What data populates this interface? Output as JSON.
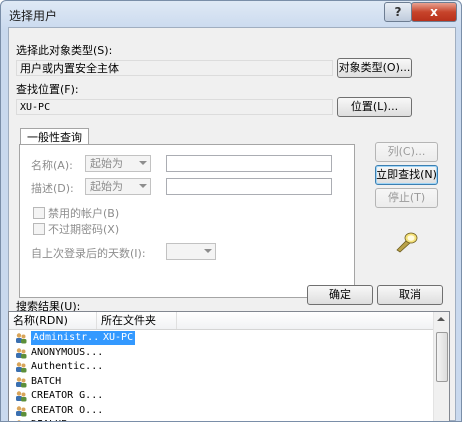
{
  "window": {
    "title": "选择用户",
    "help_label": "?",
    "close_label": "x"
  },
  "object_type": {
    "label": "选择此对象类型(S):",
    "value": "用户或内置安全主体",
    "button": "对象类型(O)..."
  },
  "location": {
    "label": "查找位置(F):",
    "value": "XU-PC",
    "button": "位置(L)..."
  },
  "query": {
    "tab": "一般性查询",
    "name_label": "名称(A):",
    "name_mode": "起始为",
    "desc_label": "描述(D):",
    "desc_mode": "起始为",
    "disabled_accounts": "禁用的帐户(B)",
    "non_expiring": "不过期密码(X)",
    "days_label": "自上次登录后的天数(I):"
  },
  "side_buttons": {
    "columns": "列(C)...",
    "find_now": "立即查找(N)",
    "stop": "停止(T)"
  },
  "actions": {
    "ok": "确定",
    "cancel": "取消"
  },
  "results": {
    "label": "搜索结果(U):",
    "columns": [
      "名称(RDN)",
      "所在文件夹"
    ],
    "rows": [
      {
        "name": "Administr...",
        "folder": "XU-PC"
      },
      {
        "name": "ANONYMOUS...",
        "folder": ""
      },
      {
        "name": "Authentic...",
        "folder": ""
      },
      {
        "name": "BATCH",
        "folder": ""
      },
      {
        "name": "CREATOR G...",
        "folder": ""
      },
      {
        "name": "CREATOR O...",
        "folder": ""
      },
      {
        "name": "DIALUP",
        "folder": ""
      }
    ]
  },
  "colors": {
    "selection": "#3399ff",
    "title_bar": "#c9d9ee",
    "close_button": "#c7442b"
  }
}
